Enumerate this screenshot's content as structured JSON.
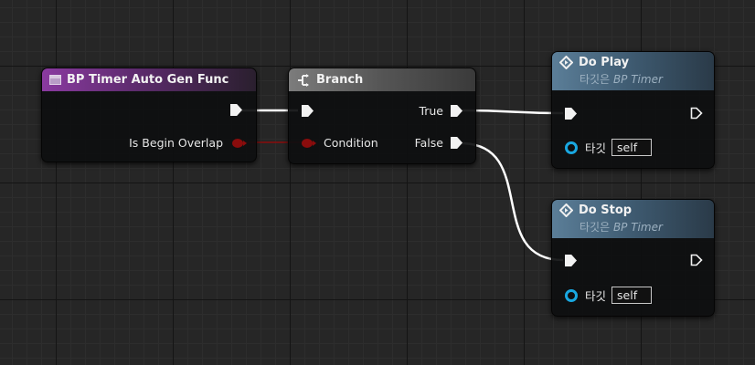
{
  "nodes": {
    "func": {
      "title": "BP Timer Auto Gen Func",
      "pins": {
        "output": "Is Begin Overlap"
      }
    },
    "branch": {
      "title": "Branch",
      "pins": {
        "condition": "Condition",
        "true": "True",
        "false": "False"
      }
    },
    "play": {
      "title": "Do Play",
      "subtitle_prefix": "타깃은 ",
      "subtitle_target": "BP Timer",
      "target_label": "타깃",
      "target_value": "self"
    },
    "stop": {
      "title": "Do Stop",
      "subtitle_prefix": "타깃은 ",
      "subtitle_target": "BP Timer",
      "target_label": "타깃",
      "target_value": "self"
    }
  },
  "colors": {
    "exec_wire": "#ffffff",
    "bool_wire": "#8a0c0c",
    "bool_pin": "#8a0c0c",
    "object_pin": "#19a7e0",
    "function_header": "#8a3aa0",
    "branch_header": "#7c7c7c",
    "call_header": "#5b7e98"
  },
  "icons": {
    "func_header": "function-icon",
    "branch_header": "branch-icon",
    "call_header": "function-call-diamond-icon"
  }
}
